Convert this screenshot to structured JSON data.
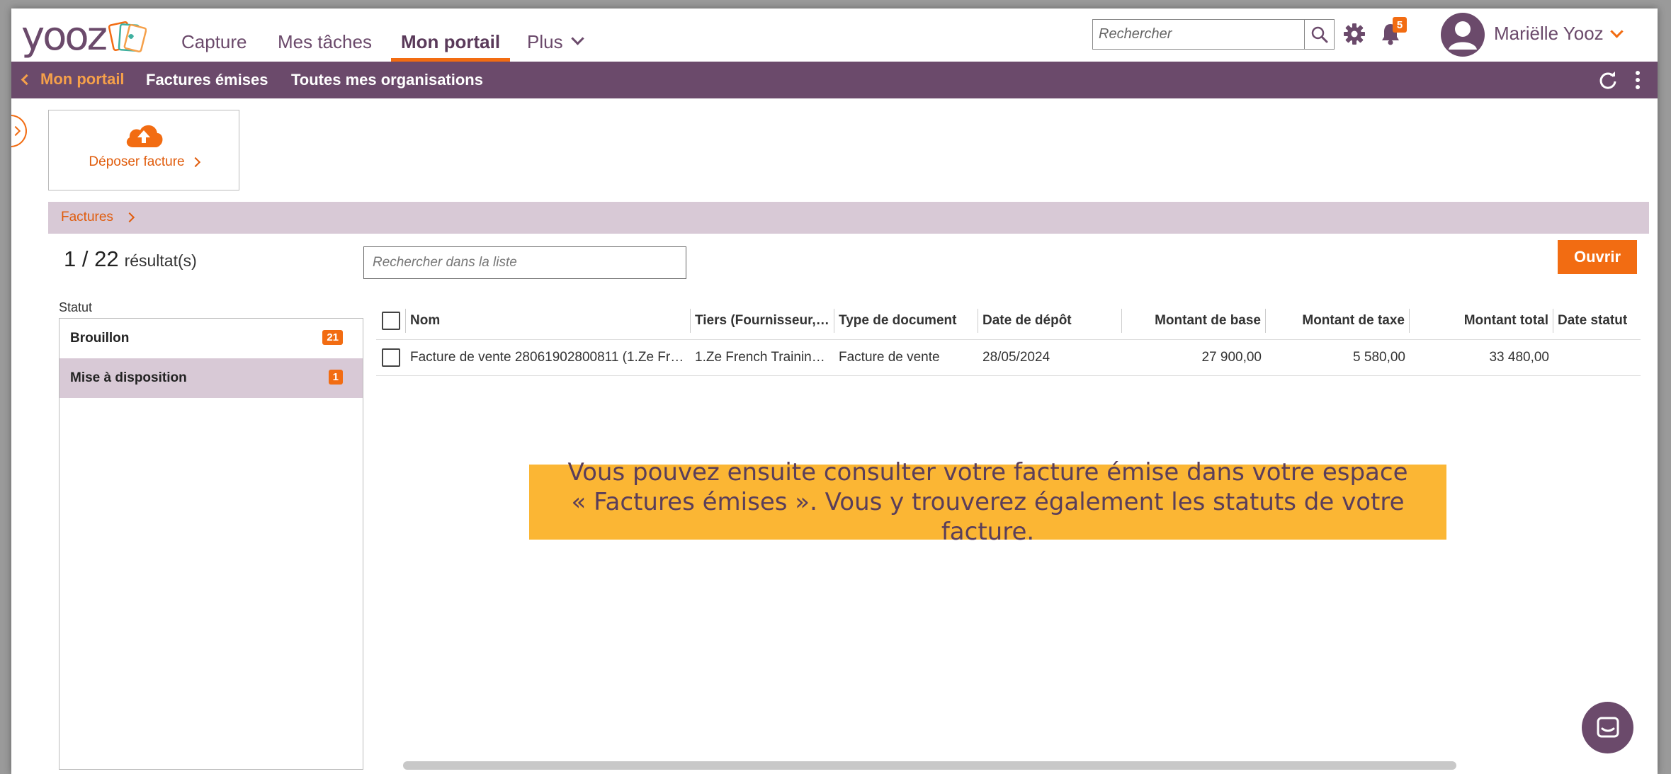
{
  "nav": {
    "logo_text": "yooz",
    "tabs": [
      {
        "label": "Capture"
      },
      {
        "label": "Mes tâches"
      },
      {
        "label": "Mon portail"
      },
      {
        "label": "Plus"
      }
    ],
    "search_placeholder": "Rechercher",
    "notification_count": "5",
    "user_name": "Mariëlle Yooz"
  },
  "subnav": {
    "back_label": "Mon portail",
    "items": [
      {
        "label": "Factures émises"
      },
      {
        "label": "Toutes mes organisations"
      }
    ]
  },
  "upload": {
    "label": "Déposer facture"
  },
  "section": {
    "title": "Factures"
  },
  "results": {
    "count": "1 / 22",
    "label": "résultat(s)"
  },
  "list_search_placeholder": "Rechercher dans la liste",
  "open_button": "Ouvrir",
  "status": {
    "label": "Statut",
    "items": [
      {
        "label": "Brouillon",
        "count": "21"
      },
      {
        "label": "Mise à disposition",
        "count": "1"
      }
    ]
  },
  "table": {
    "columns": [
      "Nom",
      "Tiers (Fournisseur, ...",
      "Type de document",
      "Date de dépôt",
      "Montant de base",
      "Montant de taxe",
      "Montant total",
      "Date statut"
    ],
    "rows": [
      [
        "Facture de vente 28061902800811 (1.Ze Fren...",
        "1.Ze French Training ...",
        "Facture de vente",
        "28/05/2024",
        "27 900,00",
        "5 580,00",
        "33 480,00",
        ""
      ]
    ]
  },
  "callout": {
    "line1": "Vous pouvez ensuite consulter votre facture émise dans votre espace",
    "line2": "« Factures émises ». Vous y trouverez également les statuts de votre facture."
  },
  "colors": {
    "brand_purple": "#6b4a6b",
    "accent_orange": "#f26c12",
    "callout_yellow": "#fbb634"
  }
}
